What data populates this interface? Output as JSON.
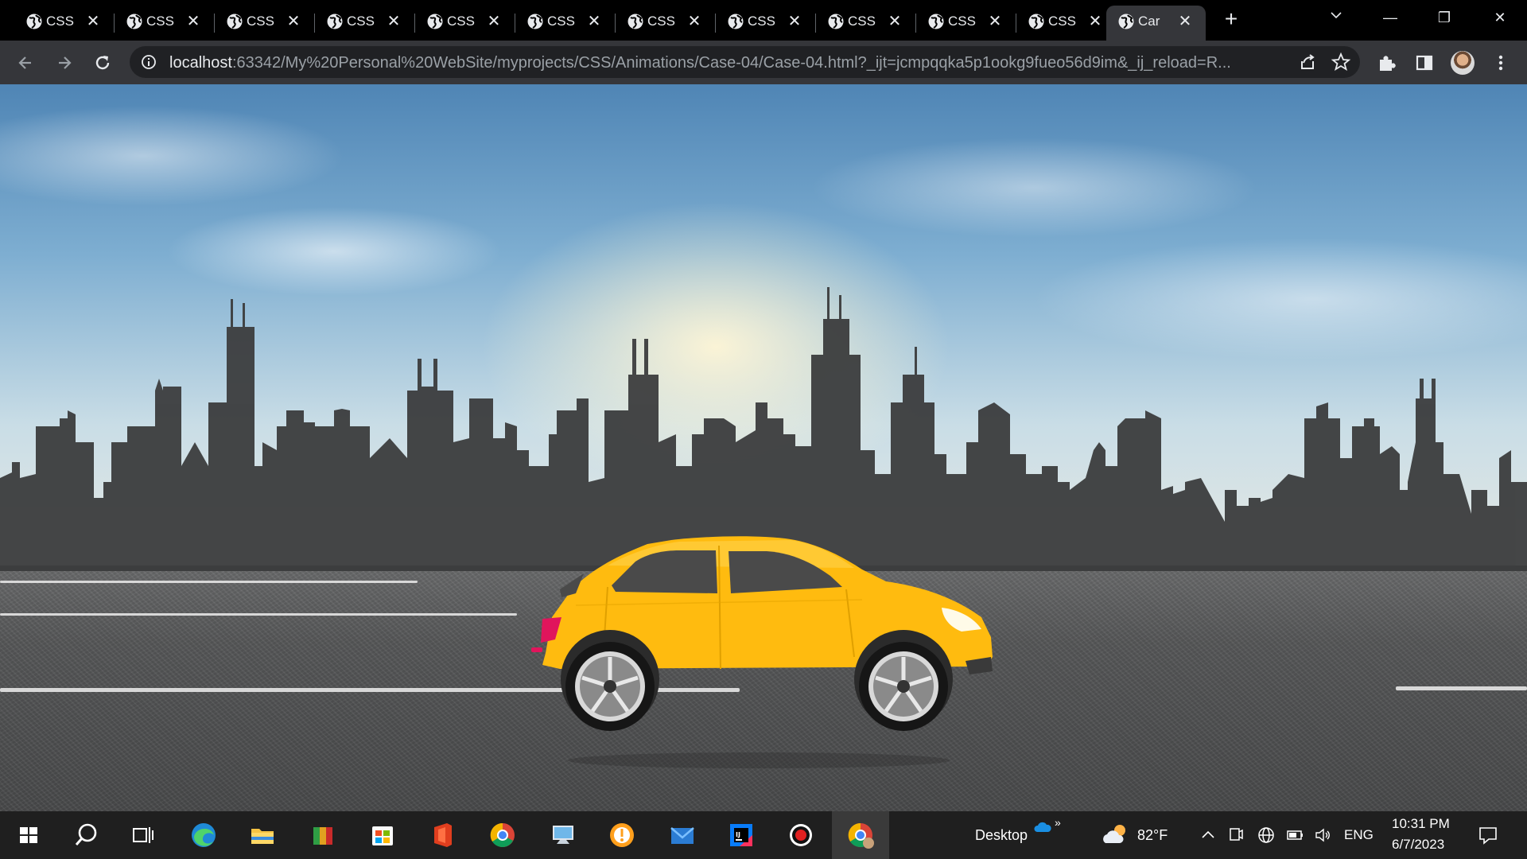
{
  "browser": {
    "tabs": [
      {
        "label": "CSS"
      },
      {
        "label": "CSS"
      },
      {
        "label": "CSS"
      },
      {
        "label": "CSS"
      },
      {
        "label": "CSS"
      },
      {
        "label": "CSS"
      },
      {
        "label": "CSS"
      },
      {
        "label": "CSS"
      },
      {
        "label": "CSS"
      },
      {
        "label": "CSS"
      },
      {
        "label": "CSS"
      },
      {
        "label": "Car"
      }
    ],
    "close_glyph": "✕",
    "new_tab_glyph": "+",
    "window_controls": {
      "minimize": "—",
      "restore": "❐",
      "close": "✕"
    },
    "url_host": "localhost",
    "url_rest": ":63342/My%20Personal%20WebSite/myprojects/CSS/Animations/Case-04/Case-04.html?_ijt=jcmpqqka5p1ookg9fueo56d9im&_ij_reload=R..."
  },
  "scene": {
    "sky_colors": [
      "#4f85b5",
      "#e6e9e4"
    ],
    "building_color": "#3c3d3e",
    "road_color": "#505152",
    "car_body_color": "#ffbb0f",
    "car_window_color": "#4a4a4a",
    "taillight_color": "#e0155c"
  },
  "taskbar": {
    "apps": [
      "start-icon",
      "search-icon",
      "task-view-icon",
      "edge-icon",
      "file-explorer-icon",
      "store-gift-icon",
      "microsoft-store-icon",
      "office-icon",
      "chrome-icon",
      "remote-desktop-icon",
      "vpn-icon",
      "mail-icon",
      "intellij-icon",
      "record-icon",
      "chrome-profile-icon"
    ],
    "desktop_label": "Desktop",
    "weather_temp": "82°F",
    "language": "ENG",
    "time": "10:31 PM",
    "date": "6/7/2023"
  }
}
